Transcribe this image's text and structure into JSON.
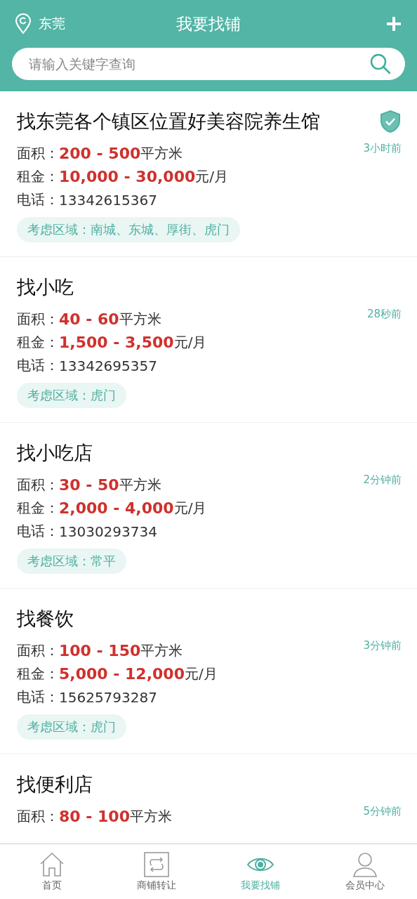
{
  "header": {
    "city": "东莞",
    "title": "我要找铺",
    "search": {
      "placeholder": "请输入关键字查询"
    }
  },
  "listings": [
    {
      "title": "找东莞各个镇区位置好美容院养生馆",
      "verified": true,
      "time": "3小时前",
      "area_label": "面积：",
      "area": "200 - 500",
      "area_unit": "平方米",
      "rent_label": "租金：",
      "rent": "10,000 - 30,000",
      "rent_unit": "元/月",
      "phone_label": "电话：",
      "phone": "13342615367",
      "region": "考虑区域：南城、东城、厚街、虎门"
    },
    {
      "title": "找小吃",
      "verified": false,
      "time": "28秒前",
      "area_label": "面积：",
      "area": "40 - 60",
      "area_unit": "平方米",
      "rent_label": "租金：",
      "rent": "1,500 - 3,500",
      "rent_unit": "元/月",
      "phone_label": "电话：",
      "phone": "13342695357",
      "region": "考虑区域：虎门"
    },
    {
      "title": "找小吃店",
      "verified": false,
      "time": "2分钟前",
      "area_label": "面积：",
      "area": "30 - 50",
      "area_unit": "平方米",
      "rent_label": "租金：",
      "rent": "2,000 - 4,000",
      "rent_unit": "元/月",
      "phone_label": "电话：",
      "phone": "13030293734",
      "region": "考虑区域：常平"
    },
    {
      "title": "找餐饮",
      "verified": false,
      "time": "3分钟前",
      "area_label": "面积：",
      "area": "100 - 150",
      "area_unit": "平方米",
      "rent_label": "租金：",
      "rent": "5,000 - 12,000",
      "rent_unit": "元/月",
      "phone_label": "电话：",
      "phone": "15625793287",
      "region": "考虑区域：虎门"
    },
    {
      "title": "找便利店",
      "verified": false,
      "time": "5分钟前",
      "area_label": "面积：",
      "area": "80 - 100",
      "area_unit": "平方米"
    }
  ],
  "tab_bar": [
    {
      "label": "首页",
      "kind": "home",
      "selected": false
    },
    {
      "label": "商铺转让",
      "kind": "transfer",
      "selected": false
    },
    {
      "label": "我要找铺",
      "kind": "eye",
      "selected": true
    },
    {
      "label": "会员中心",
      "kind": "user",
      "selected": false
    }
  ]
}
